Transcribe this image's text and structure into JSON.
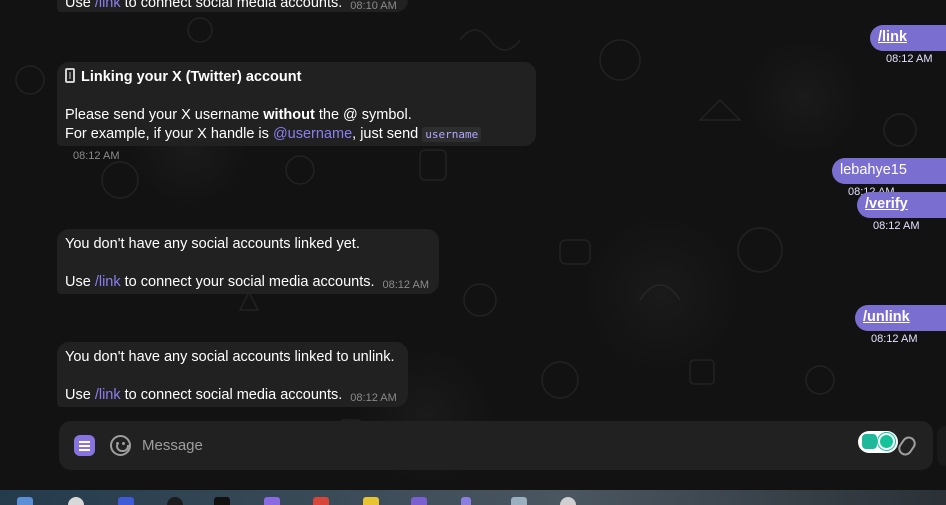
{
  "messages": {
    "top_partial": {
      "text_pre": "Use ",
      "cmd": "/link",
      "text_post": " to connect social media accounts.",
      "time": "08:10 AM"
    },
    "out_link": {
      "text": "/link",
      "time": "08:12 AM"
    },
    "linking": {
      "title": "Linking your X (Twitter) account",
      "line1_pre": "Please send your X username ",
      "line1_bold": "without",
      "line1_post": " the @ symbol.",
      "line2_pre": "For example, if your X handle is ",
      "mention": "@username",
      "line2_mid": ", just send ",
      "code": "username",
      "time": "08:12 AM"
    },
    "out_username": {
      "text": "lebahye15",
      "time": "08:12 AM"
    },
    "out_verify": {
      "text": "/verify",
      "time": "08:12 AM"
    },
    "no_accounts": {
      "line1": "You don't have any social accounts linked yet.",
      "line2_pre": "Use ",
      "cmd": "/link",
      "line2_post": " to connect your social media accounts.",
      "time": "08:12 AM"
    },
    "out_unlink": {
      "text": "/unlink",
      "time": "08:12 AM"
    },
    "no_unlink": {
      "line1": "You don't have any social accounts linked to unlink.",
      "line2_pre": "Use ",
      "cmd": "/link",
      "line2_post": " to connect social media accounts.",
      "time": "08:12 AM"
    }
  },
  "composer": {
    "placeholder": "Message",
    "icons": [
      "menu-icon",
      "emoji-icon",
      "extension-icon",
      "paperclip-icon"
    ]
  },
  "colors": {
    "accent": "#8774e1",
    "outgoing_bubble": "#7b6ed1",
    "incoming_bubble": "#212121",
    "background": "#121212"
  }
}
